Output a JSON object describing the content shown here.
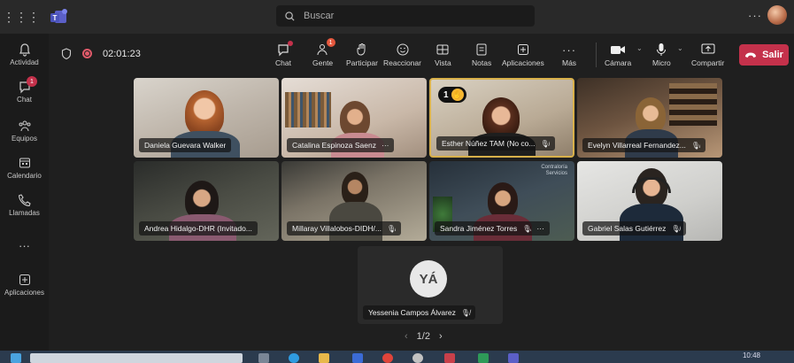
{
  "search": {
    "placeholder": "Buscar"
  },
  "rail": [
    {
      "label": "Actividad",
      "icon": "bell-icon"
    },
    {
      "label": "Chat",
      "icon": "chat-icon",
      "badge": "1"
    },
    {
      "label": "Equipos",
      "icon": "teams-icon"
    },
    {
      "label": "Calendario",
      "icon": "calendar-icon"
    },
    {
      "label": "Llamadas",
      "icon": "phone-icon"
    },
    {
      "label": "Aplicaciones",
      "icon": "add-app-icon"
    }
  ],
  "toolbar": {
    "timer": "02:01:23",
    "buttons": {
      "chat": "Chat",
      "people": "Gente",
      "people_badge": "1",
      "raise": "Participar",
      "react": "Reaccionar",
      "view": "Vista",
      "notes": "Notas",
      "apps": "Aplicaciones",
      "more": "Más",
      "camera": "Cámara",
      "mic": "Micro",
      "share": "Compartir",
      "leave": "Salir"
    }
  },
  "participants": [
    {
      "name": "Daniela Guevara Walker",
      "muted": false
    },
    {
      "name": "Catalina Espinoza Saenz",
      "muted": false,
      "more": "···"
    },
    {
      "name": "Esther Núñez TAM (No co...",
      "muted": true,
      "hand_raised": "1",
      "active": true
    },
    {
      "name": "Evelyn Villarreal Fernandez...",
      "muted": true
    },
    {
      "name": "Andrea Hidalgo-DHR (Invitado...",
      "muted": false
    },
    {
      "name": "Millaray Villalobos-DIDH/...",
      "muted": true
    },
    {
      "name": "Sandra Jiménez Torres",
      "muted": true,
      "more": "···"
    },
    {
      "name": "Gabriel Salas Gutiérrez",
      "muted": true
    }
  ],
  "wall_sign": {
    "line1": "Contraloría",
    "line2": "Servicios"
  },
  "audio_participant": {
    "initials": "YÁ",
    "name": "Yessenia Campos Álvarez"
  },
  "pager": {
    "label": "1/2"
  },
  "clock": {
    "time": "10:48"
  },
  "colors": {
    "leave": "#c4314b",
    "badge": "#c4314b",
    "hand": "#f7b731"
  }
}
